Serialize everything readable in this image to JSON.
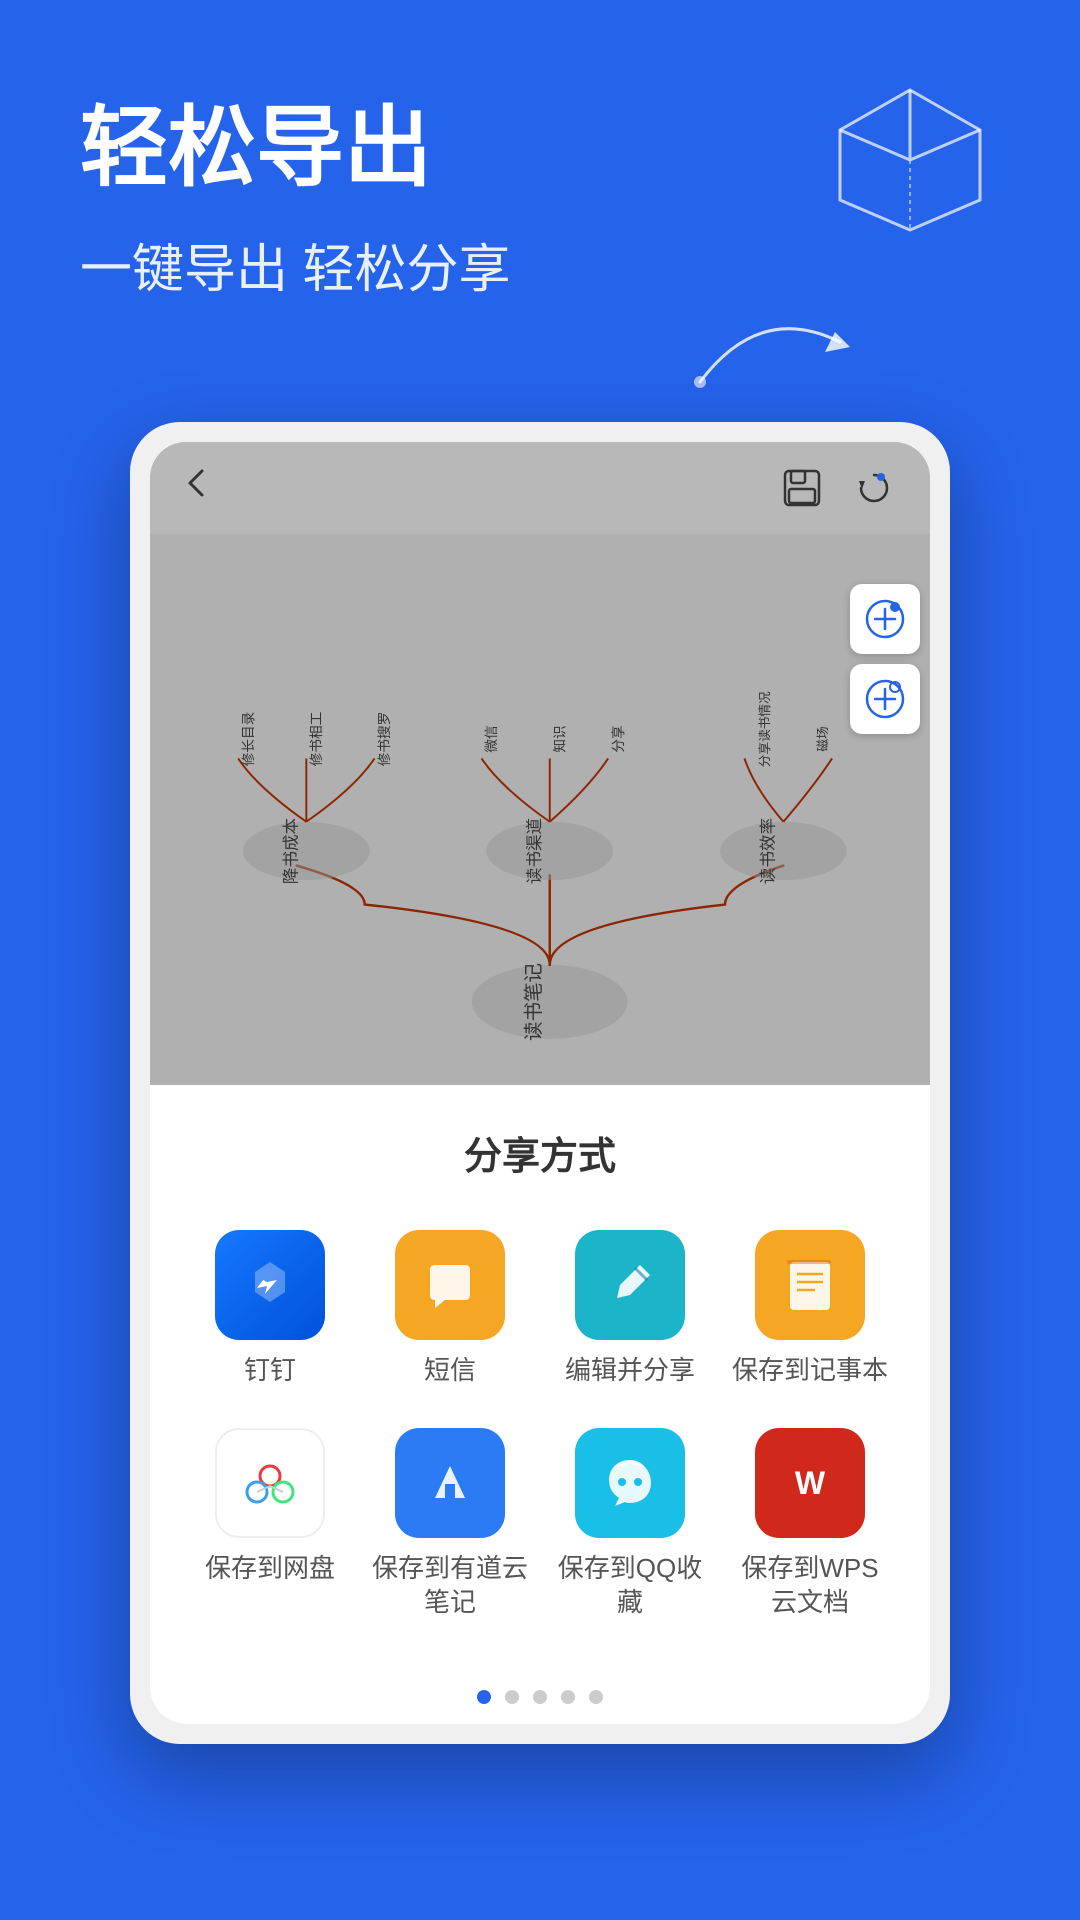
{
  "header": {
    "main_title": "轻松导出",
    "sub_title": "一键导出 轻松分享"
  },
  "phone": {
    "back_icon": "‹",
    "save_icon": "💾",
    "refresh_icon": "↻"
  },
  "mindmap": {
    "root_label": "读书笔记",
    "branch1": "降书成本",
    "branch2": "读书渠道",
    "branch3": "读书效率",
    "sub1_1": "修长目录",
    "sub1_2": "修书相工",
    "sub1_3": "修书搜罗",
    "sub2_1": "微信",
    "sub2_2": "知识",
    "sub2_3": "分享",
    "sub3_1": "分享读书情况",
    "sub3_2": "磁场"
  },
  "share_sheet": {
    "title": "分享方式",
    "items": [
      {
        "id": "dingtalk",
        "label": "钉钉",
        "color": "#1677ff"
      },
      {
        "id": "sms",
        "label": "短信",
        "color": "#F5A623"
      },
      {
        "id": "edit_share",
        "label": "编辑并分享",
        "color": "#1BB4C8"
      },
      {
        "id": "notes",
        "label": "保存到记事本",
        "color": "#F5A623"
      },
      {
        "id": "netdisk",
        "label": "保存到网盘",
        "color": "#ffffff"
      },
      {
        "id": "youdao",
        "label": "保存到有道云笔记",
        "color": "#2B7BF5"
      },
      {
        "id": "qq_collect",
        "label": "保存到QQ收藏",
        "color": "#1ABFE8"
      },
      {
        "id": "wps",
        "label": "保存到WPS云文档",
        "color": "#D0291C"
      }
    ]
  },
  "page_dots": {
    "total": 5,
    "active": 0
  }
}
